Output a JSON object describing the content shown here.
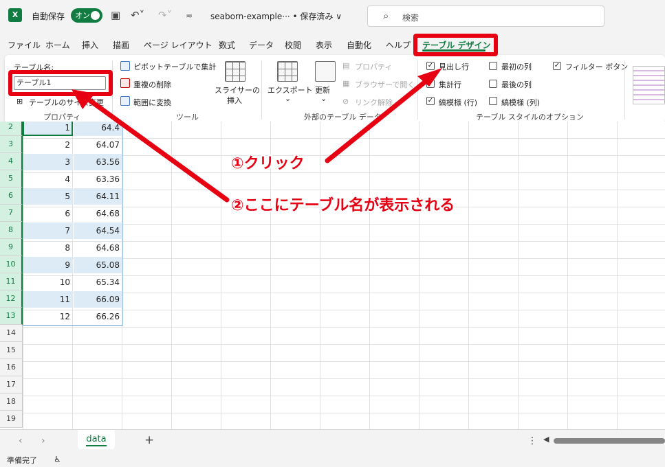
{
  "titlebar": {
    "app_icon": "X",
    "autosave_label": "自動保存",
    "autosave_toggle": "オン",
    "filename": "seaborn-example··· • 保存済み ∨",
    "search_placeholder": "検索"
  },
  "menu": {
    "tabs": [
      "ファイル",
      "ホーム",
      "挿入",
      "描画",
      "ページ レイアウト",
      "数式",
      "データ",
      "校閲",
      "表示",
      "自動化",
      "ヘルプ"
    ],
    "active_tab": "テーブル デザイン"
  },
  "ribbon": {
    "properties": {
      "table_name_label": "テーブル名:",
      "table_name_value": "テーブル1",
      "resize_label": "テーブルのサイズ変更",
      "group": "プロパティ"
    },
    "tools": {
      "pivot": "ピボットテーブルで集計",
      "remove_dup": "重複の削除",
      "convert_range": "範囲に変換",
      "slicer_line1": "スライサーの",
      "slicer_line2": "挿入",
      "group": "ツール"
    },
    "external": {
      "export": "エクスポート",
      "refresh": "更新",
      "properties": "プロパティ",
      "open_browser": "ブラウザーで開く",
      "unlink": "リンク解除",
      "group": "外部のテーブル データ"
    },
    "style_options": {
      "header_row": "見出し行",
      "total_row": "集計行",
      "banded_rows": "縞模様 (行)",
      "first_col": "最初の列",
      "last_col": "最後の列",
      "banded_cols": "縞模様 (列)",
      "filter_button": "フィルター ボタン",
      "group": "テーブル スタイルのオプション"
    }
  },
  "grid": {
    "row_numbers": [
      "2",
      "3",
      "4",
      "5",
      "6",
      "7",
      "8",
      "9",
      "10",
      "11",
      "12",
      "13",
      "14",
      "15",
      "16",
      "17",
      "18",
      "19"
    ],
    "rows": [
      {
        "a": "1",
        "b": "64.4"
      },
      {
        "a": "2",
        "b": "64.07"
      },
      {
        "a": "3",
        "b": "63.56"
      },
      {
        "a": "4",
        "b": "63.36"
      },
      {
        "a": "5",
        "b": "64.11"
      },
      {
        "a": "6",
        "b": "64.68"
      },
      {
        "a": "7",
        "b": "64.54"
      },
      {
        "a": "8",
        "b": "64.68"
      },
      {
        "a": "9",
        "b": "65.08"
      },
      {
        "a": "10",
        "b": "65.34"
      },
      {
        "a": "11",
        "b": "66.09"
      },
      {
        "a": "12",
        "b": "66.26"
      }
    ]
  },
  "annotations": {
    "click": "①クリック",
    "shown_here": "②ここにテーブル名が表示される",
    "color": "#e60012"
  },
  "sheets": {
    "tabs": [
      "data"
    ],
    "add": "+"
  },
  "status": {
    "ready": "準備完了"
  }
}
